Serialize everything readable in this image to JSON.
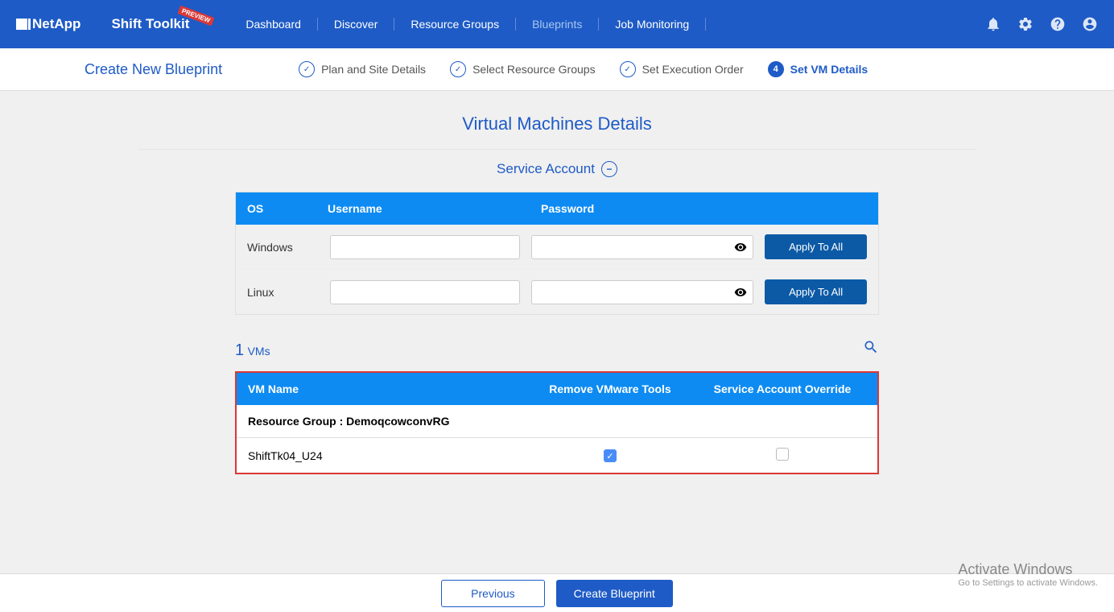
{
  "brand": "NetApp",
  "app_name": "Shift Toolkit",
  "preview_label": "PREVIEW",
  "nav": [
    "Dashboard",
    "Discover",
    "Resource Groups",
    "Blueprints",
    "Job Monitoring"
  ],
  "nav_active_index": 3,
  "wizard": {
    "title": "Create New Blueprint",
    "steps": [
      "Plan and Site Details",
      "Select Resource Groups",
      "Set Execution Order",
      "Set VM Details"
    ],
    "current_index": 3
  },
  "section_title": "Virtual Machines Details",
  "service_account": {
    "label": "Service Account",
    "headers": {
      "os": "OS",
      "user": "Username",
      "pass": "Password"
    },
    "rows": [
      {
        "os": "Windows",
        "user": "",
        "pass": "",
        "apply": "Apply To All"
      },
      {
        "os": "Linux",
        "user": "",
        "pass": "",
        "apply": "Apply To All"
      }
    ]
  },
  "vms": {
    "count": "1",
    "count_label": "VMs",
    "headers": {
      "name": "VM Name",
      "remove": "Remove VMware Tools",
      "override": "Service Account Override"
    },
    "group_label": "Resource Group : DemoqcowconvRG",
    "rows": [
      {
        "name": "ShiftTk04_U24",
        "remove_checked": true,
        "override_checked": false
      }
    ]
  },
  "buttons": {
    "previous": "Previous",
    "create": "Create Blueprint"
  },
  "watermark": {
    "title": "Activate Windows",
    "sub": "Go to Settings to activate Windows."
  }
}
